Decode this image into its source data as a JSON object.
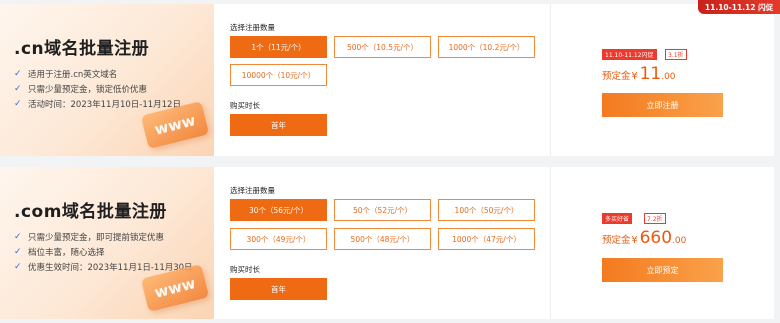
{
  "ribbon": "11.10-11.12 闪促",
  "cards": [
    {
      "title": ".cn域名批量注册",
      "bullets": [
        "适用于注册.cn英文域名",
        "只需少量预定金，锁定低价优惠",
        "活动时间：2023年11月10日-11月12日"
      ],
      "www": "www",
      "quantity_label": "选择注册数量",
      "options": [
        "1个（11元/个）",
        "500个（10.5元/个）",
        "1000个（10.2元/个）",
        "10000个（10元/个）"
      ],
      "selected_option": "1个（11元/个）",
      "duration_label": "购买时长",
      "duration": "首年",
      "promo_tag": "11.10-11.12闪促",
      "discount_tag": "3.1折",
      "price_label": "预定金",
      "currency": "¥",
      "price_int": "11",
      "price_dec": ".00",
      "cta": "立即注册"
    },
    {
      "title": ".com域名批量注册",
      "bullets": [
        "只需少量预定金，即可提前锁定优惠",
        "档位丰富，随心选择",
        "优惠生效时间：2023年11月1日-11月30日"
      ],
      "www": "www",
      "quantity_label": "选择注册数量",
      "options": [
        "30个（56元/个）",
        "50个（52元/个）",
        "100个（50元/个）",
        "300个（49元/个）",
        "500个（48元/个）",
        "1000个（47元/个）"
      ],
      "selected_option": "30个（56元/个）",
      "duration_label": "购买时长",
      "duration": "首年",
      "promo_tag": "多买好省",
      "discount_tag": "7.2折",
      "price_label": "预定金",
      "currency": "¥",
      "price_int": "660",
      "price_dec": ".00",
      "cta": "立即预定"
    }
  ],
  "colors": {
    "accent": "#ee6a13",
    "promo": "#ea3b2c",
    "check": "#2f6fd6"
  }
}
